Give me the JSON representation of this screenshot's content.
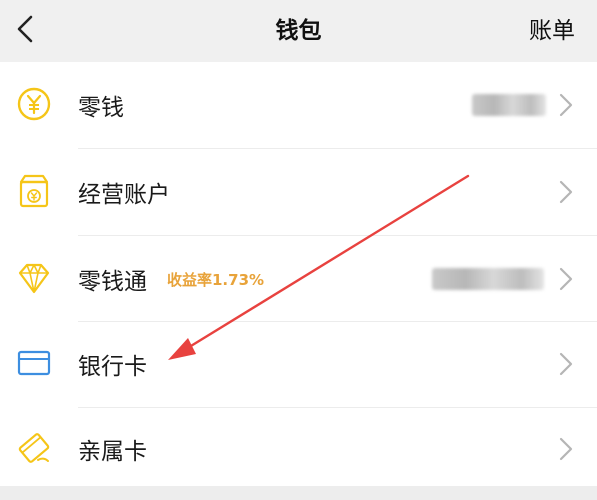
{
  "header": {
    "title": "钱包",
    "bill_label": "账单"
  },
  "menu": {
    "items": [
      {
        "label": "零钱",
        "icon": "yuan-coin-icon"
      },
      {
        "label": "经营账户",
        "icon": "merchant-account-icon"
      },
      {
        "label": "零钱通",
        "icon": "diamond-icon",
        "yield_label": "收益率1.73%"
      },
      {
        "label": "银行卡",
        "icon": "bank-card-icon"
      },
      {
        "label": "亲属卡",
        "icon": "family-card-icon"
      }
    ]
  },
  "colors": {
    "header_bg": "#f0f0f0",
    "icon_yellow": "#f5c518",
    "icon_blue": "#3d8ee0",
    "yield_orange": "#e8a33a",
    "annotation_red": "#e8423f"
  }
}
